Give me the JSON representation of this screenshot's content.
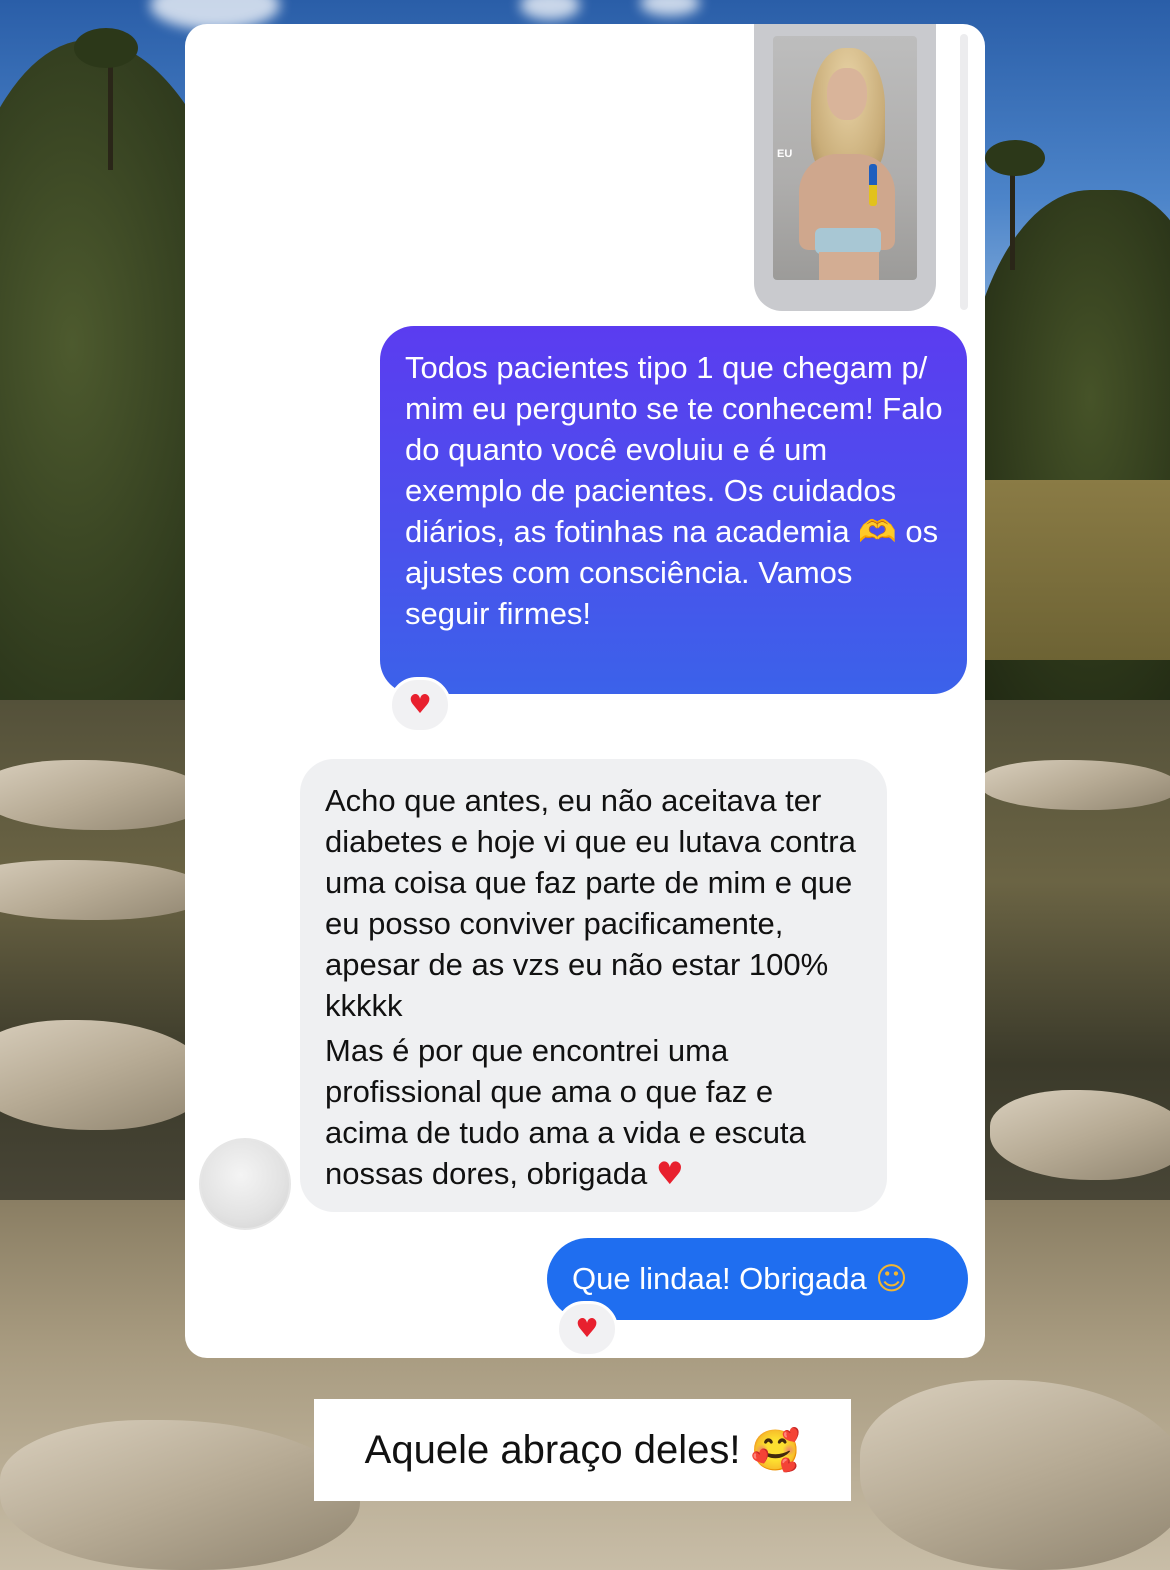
{
  "shared_reel": {
    "overlay_label": "EU"
  },
  "messages": [
    {
      "id": "msg1",
      "sender": "self",
      "text": "Todos pacientes tipo 1 que chegam p/ mim eu pergunto se te conhecem! Falo do quanto você evoluiu e é um exemplo de pacientes. Os cuidados diários, as fotinhas na academia 🫶 os ajustes com consciência. Vamos seguir firmes!",
      "reaction": "♥"
    },
    {
      "id": "msg2",
      "sender": "other",
      "text_part1": "Acho que antes, eu não aceitava ter diabetes e hoje vi que eu lutava contra uma coisa que faz parte de mim e que eu posso conviver pacificamente, apesar de as vzs eu não estar 100% kkkkk",
      "text_part2": "Mas é por que encontrei uma profissional que ama o que faz e acima de tudo ama a vida e escuta nossas dores, obrigada",
      "trailing_emoji": "♥"
    },
    {
      "id": "msg3",
      "sender": "self",
      "text": "Que lindaa! Obrigada",
      "trailing_emoji": "☺",
      "reaction": "♥"
    }
  ],
  "caption": {
    "text": "Aquele abraço deles!",
    "emoji": "🥰"
  },
  "colors": {
    "bubble_self_gradient_start": "#5b3cf0",
    "bubble_self_gradient_end": "#3b62ea",
    "bubble_self_blue": "#1f6ef0",
    "bubble_other": "#eff0f2",
    "reaction_heart": "#e8202e"
  }
}
